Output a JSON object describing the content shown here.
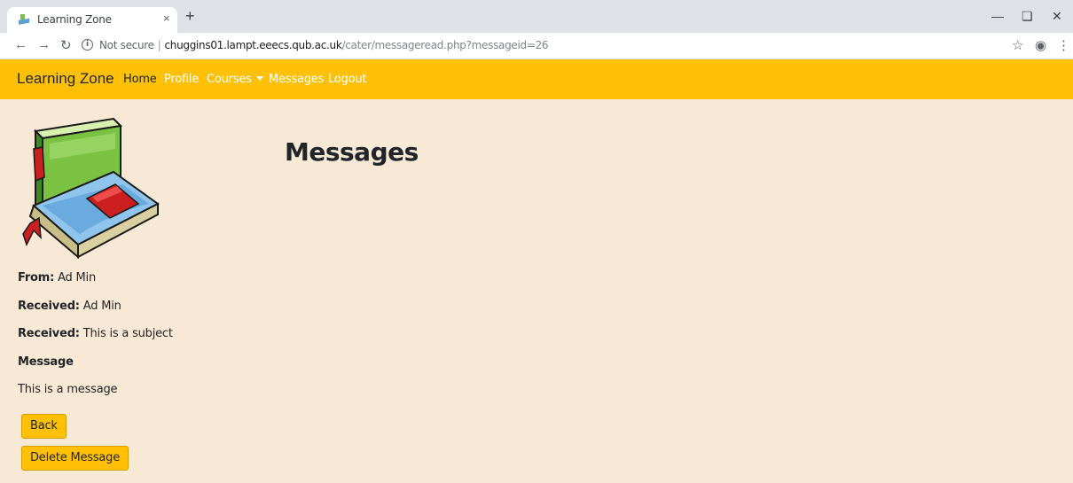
{
  "browser": {
    "tab_title": "Learning Zone",
    "tab_close": "×",
    "new_tab": "+",
    "security_label": "Not secure",
    "url_host": "chuggins01.lampt.eeecs.qub.ac.uk",
    "url_path": "/cater/messageread.php?messageid=26",
    "icons": [
      "back-icon",
      "forward-icon",
      "reload-icon",
      "info-icon",
      "star-icon",
      "account-icon",
      "menu-icon"
    ]
  },
  "nav": {
    "brand": "Learning Zone",
    "links": [
      "Home",
      "Profile",
      "Courses",
      "Messages",
      "Logout"
    ],
    "bg_color": "#ffc107"
  },
  "page": {
    "title": "Messages",
    "from_label": "From:",
    "from_value": "Ad Min",
    "received_label": "Received:",
    "received_value": "Ad Min",
    "subject_label": "Received:",
    "subject_value": "This is a subject",
    "message_label": "Message",
    "message_body": "This is a message",
    "back_button": "Back",
    "delete_button": "Delete Message",
    "bg_color": "#f8e9d6"
  }
}
